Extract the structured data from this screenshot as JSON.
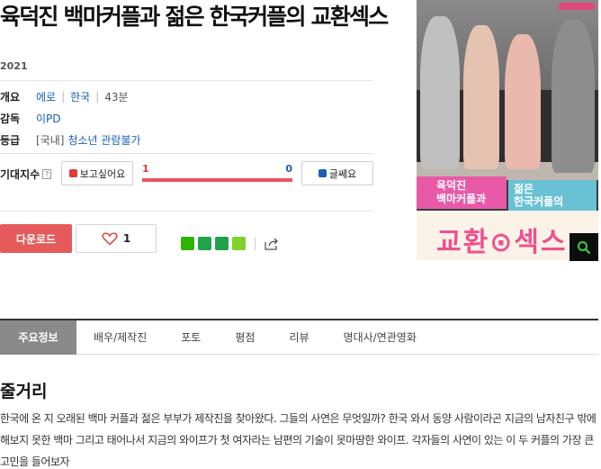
{
  "movie": {
    "title": "육덕진 백마커플과 젊은 한국커플의 교환섹스",
    "year": "2021"
  },
  "info": {
    "overview_label": "개요",
    "genre": "에로",
    "country": "한국",
    "runtime": "43분",
    "director_label": "감독",
    "director": "이PD",
    "rating_label": "등급",
    "rating_prefix": "[국내]",
    "rating": "청소년 관람불가"
  },
  "expectation": {
    "label": "기대지수",
    "help_icon": "?",
    "want_label": "보고싶어요",
    "want_count": "1",
    "meh_count": "0",
    "meh_label": "글쎄요",
    "want_fraction": 1.0
  },
  "actions": {
    "download_label": "다운로드",
    "like_count": "1"
  },
  "share_icons": [
    "blog-icon",
    "kakaostory-icon",
    "band-icon",
    "line-icon",
    "share-icon"
  ],
  "poster": {
    "title_line1": "육덕진",
    "title_line2": "백마커플과",
    "title_line3": "젊은",
    "title_line4": "한국커플의",
    "title_big": "교환⊙섹스"
  },
  "tabs": [
    {
      "label": "주요정보",
      "active": true
    },
    {
      "label": "배우/제작진",
      "active": false
    },
    {
      "label": "포토",
      "active": false
    },
    {
      "label": "평점",
      "active": false
    },
    {
      "label": "리뷰",
      "active": false
    },
    {
      "label": "명대사/연관영화",
      "active": false
    }
  ],
  "synopsis": {
    "heading": "줄거리",
    "text": "한국에 온 지 오래된 백마 커플과 젊은 부부가 제작진을 찾아왔다. 그들의 사연은 무엇일까? 한국 와서 동양 사람이라곤 지금의 남자친구 밖에 해보지 못한 백마 그리고 태어나서 지금의 와이프가 첫 여자라는 남편의 기술이 못마땅한 와이프. 각자들의 사연이 있는 이 두 커플의 가장 큰 고민을 들어보자"
  },
  "colors": {
    "accent_red": "#e55a5a",
    "link_blue": "#1a5fb4",
    "tab_active": "#8a8a8a"
  }
}
